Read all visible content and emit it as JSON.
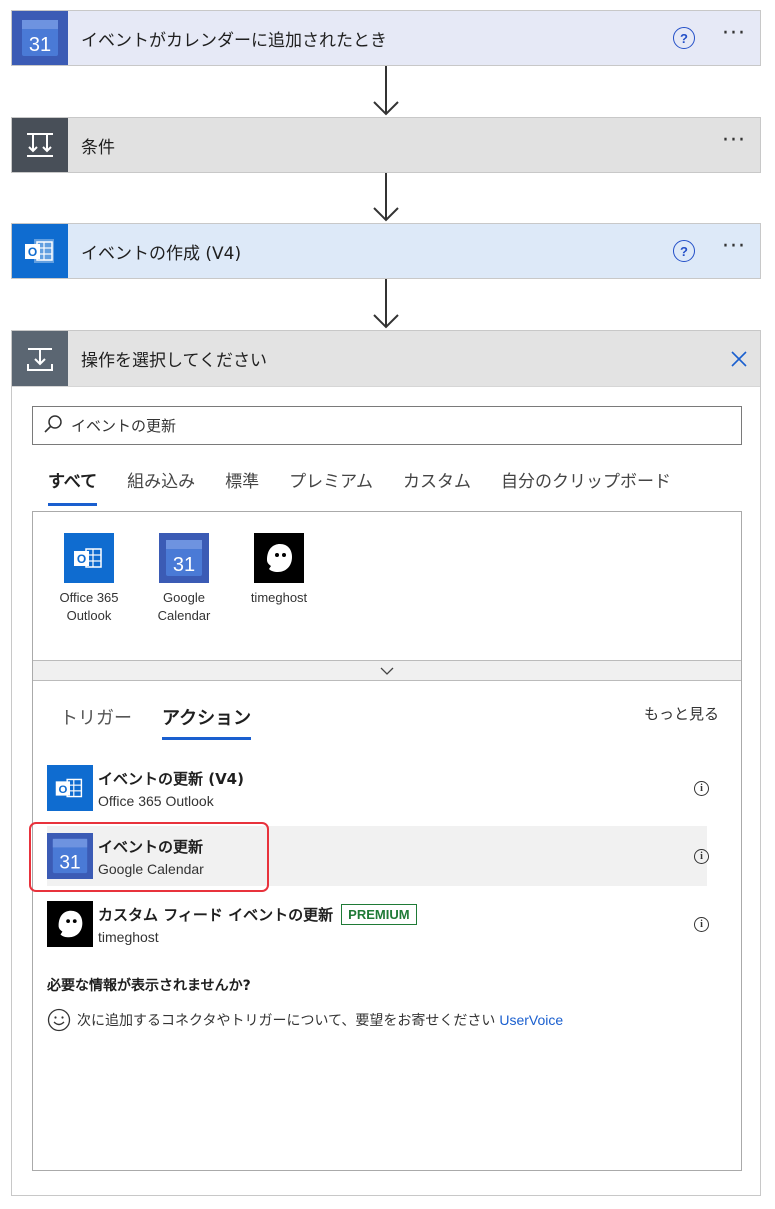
{
  "steps": [
    {
      "title": "イベントがカレンダーに追加されたとき",
      "icon": "google-calendar-icon",
      "help": "?",
      "more": "···"
    },
    {
      "title": "条件",
      "icon": "condition-icon",
      "more": "···"
    },
    {
      "title": "イベントの作成 (V4)",
      "icon": "outlook-icon",
      "help": "?",
      "more": "···"
    }
  ],
  "chooser": {
    "title": "操作を選択してください",
    "search_value": "イベントの更新",
    "tabs": [
      "すべて",
      "組み込み",
      "標準",
      "プレミアム",
      "カスタム",
      "自分のクリップボード"
    ],
    "active_tab": "すべて",
    "connectors": [
      {
        "label_line1": "Office 365",
        "label_line2": "Outlook",
        "icon": "outlook-icon"
      },
      {
        "label_line1": "Google",
        "label_line2": "Calendar",
        "icon": "google-calendar-icon"
      },
      {
        "label_line1": "timeghost",
        "label_line2": "",
        "icon": "timeghost-icon"
      }
    ],
    "subtabs": [
      "トリガー",
      "アクション"
    ],
    "active_subtab": "アクション",
    "see_more": "もっと見る",
    "actions": [
      {
        "name": "イベントの更新 (V4)",
        "connector": "Office 365 Outlook",
        "icon": "outlook-icon",
        "info": "i"
      },
      {
        "name": "イベントの更新",
        "connector": "Google Calendar",
        "icon": "google-calendar-icon",
        "info": "i",
        "highlighted": true
      },
      {
        "name": "カスタム フィード イベントの更新",
        "connector": "timeghost",
        "icon": "timeghost-icon",
        "badge": "PREMIUM",
        "info": "i"
      }
    ],
    "missing_heading": "必要な情報が表示されませんか?",
    "missing_text": "次に追加するコネクタやトリガーについて、要望をお寄せください",
    "missing_link": "UserVoice"
  },
  "calendar_day": "31",
  "colors": {
    "accent": "#1a5fcf",
    "highlight": "#e8323c",
    "premium": "#1f7a36"
  }
}
